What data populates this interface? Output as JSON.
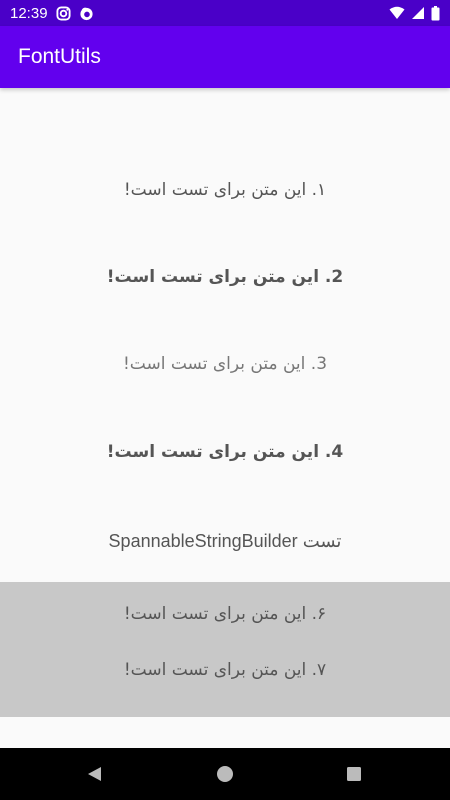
{
  "status_bar": {
    "time": "12:39",
    "left_icons": [
      "instagram-icon",
      "firefox-icon"
    ],
    "right_icons": [
      "wifi-icon",
      "cellular-icon",
      "battery-icon"
    ]
  },
  "app_bar": {
    "title": "FontUtils"
  },
  "lines": [
    {
      "text": "۱. این متن برای تست است!"
    },
    {
      "text": "2. این متن برای تست است!"
    },
    {
      "text": "3. این متن برای تست است!"
    },
    {
      "text": "4. این متن برای تست است!"
    },
    {
      "text": "تست SpannableStringBuilder"
    },
    {
      "text": "۶. این متن برای تست است!"
    },
    {
      "text": "۷. این متن برای تست است!"
    }
  ],
  "nav_bar": {
    "buttons": [
      "back-icon",
      "home-icon",
      "recents-icon"
    ]
  }
}
